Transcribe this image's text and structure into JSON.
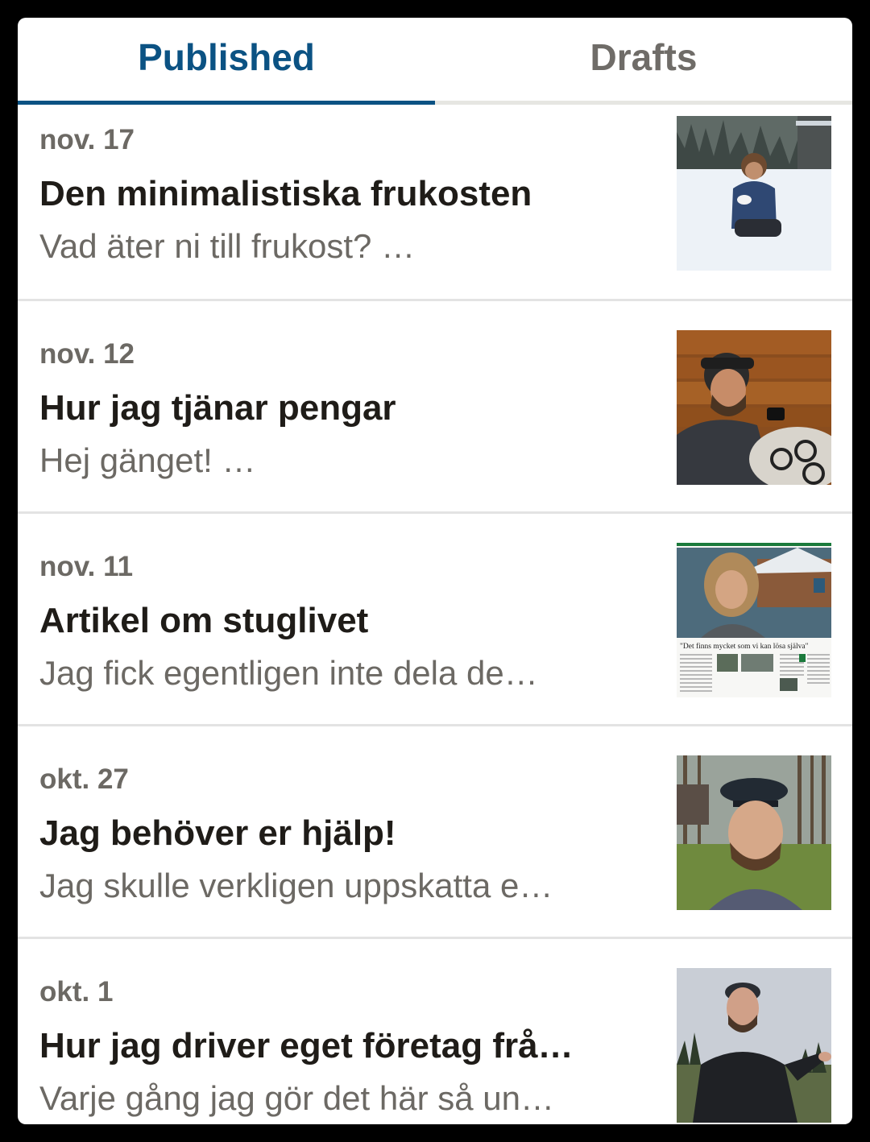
{
  "tabs": {
    "published_label": "Published",
    "drafts_label": "Drafts",
    "active": "published"
  },
  "colors": {
    "accent": "#0b5283",
    "title_text": "#1f1c18",
    "secondary_text": "#6c6964",
    "divider": "#e3e3e3"
  },
  "posts": [
    {
      "date": "nov. 17",
      "title": "Den minimalistiska frukosten",
      "excerpt": "Vad äter ni till frukost? …",
      "thumbnail": "photo-man-eating-in-snow"
    },
    {
      "date": "nov. 12",
      "title": "Hur jag tjänar pengar",
      "excerpt": "Hej gänget! …",
      "thumbnail": "photo-man-with-phone-in-cabin"
    },
    {
      "date": "nov. 11",
      "title": "Artikel om stuglivet",
      "excerpt": "Jag fick egentligen inte dela de…",
      "thumbnail": "photo-newspaper-article",
      "thumbnail_text": {
        "headline": "\"Det finns mycket som vi kan lösa själva\""
      }
    },
    {
      "date": "okt. 27",
      "title": "Jag behöver er hjälp!",
      "excerpt": "Jag skulle verkligen uppskatta e…",
      "thumbnail": "photo-man-with-cap-in-forest"
    },
    {
      "date": "okt. 1",
      "title": "Hur jag driver eget företag frå…",
      "excerpt": "Varje gång jag gör det här så un…",
      "thumbnail": "photo-man-outdoors-landscape"
    }
  ]
}
